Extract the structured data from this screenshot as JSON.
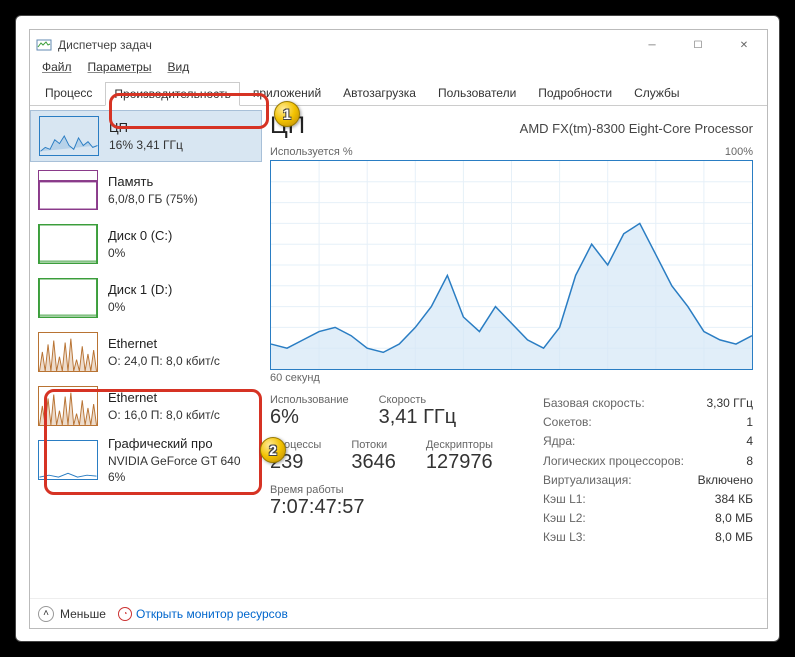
{
  "window": {
    "title": "Диспетчер задач"
  },
  "menus": {
    "file": "Файл",
    "options": "Параметры",
    "view": "Вид"
  },
  "tabs": {
    "processes": "Процесс",
    "performance": "Производительность",
    "apphistory": "приложений",
    "startup": "Автозагрузка",
    "users": "Пользователи",
    "details": "Подробности",
    "services": "Службы"
  },
  "sidebar": [
    {
      "name": "ЦП",
      "sub": "16% 3,41 ГГц",
      "color": "#2a7dc3",
      "type": "cpu"
    },
    {
      "name": "Память",
      "sub": "6,0/8,0 ГБ (75%)",
      "color": "#8a3a8a",
      "type": "mem"
    },
    {
      "name": "Диск 0 (C:)",
      "sub": "0%",
      "color": "#3b9e3b",
      "type": "disk"
    },
    {
      "name": "Диск 1 (D:)",
      "sub": "0%",
      "color": "#3b9e3b",
      "type": "disk"
    },
    {
      "name": "Ethernet",
      "sub": "О: 24,0 П: 8,0 кбит/с",
      "color": "#b87333",
      "type": "net"
    },
    {
      "name": "Ethernet",
      "sub": "О: 16,0 П: 8,0 кбит/с",
      "color": "#b87333",
      "type": "net"
    },
    {
      "name": "Графический про",
      "sub": "NVIDIA GeForce GT 640\n6%",
      "color": "#2a7dc3",
      "type": "gpu"
    }
  ],
  "main": {
    "title": "ЦП",
    "subtitle": "AMD FX(tm)-8300 Eight-Core Processor",
    "y_label": "Используется %",
    "y_max": "100%",
    "x_label": "60 секунд",
    "left_stats": {
      "usage": {
        "label": "Использование",
        "value": "6%"
      },
      "speed": {
        "label": "Скорость",
        "value": "3,41 ГГц"
      },
      "processes": {
        "label": "Процессы",
        "value": "239"
      },
      "threads": {
        "label": "Потоки",
        "value": "3646"
      },
      "handles": {
        "label": "Дескрипторы",
        "value": "127976"
      },
      "uptime_label": "Время работы",
      "uptime": "7:07:47:57"
    },
    "right_stats": [
      {
        "k": "Базовая скорость:",
        "v": "3,30 ГГц"
      },
      {
        "k": "Сокетов:",
        "v": "1"
      },
      {
        "k": "Ядра:",
        "v": "4"
      },
      {
        "k": "Логических процессоров:",
        "v": "8"
      },
      {
        "k": "Виртуализация:",
        "v": "Включено"
      },
      {
        "k": "Кэш L1:",
        "v": "384 КБ"
      },
      {
        "k": "Кэш L2:",
        "v": "8,0 МБ"
      },
      {
        "k": "Кэш L3:",
        "v": "8,0 МБ"
      }
    ]
  },
  "footer": {
    "fewer": "Меньше",
    "resmon": "Открыть монитор ресурсов"
  },
  "callouts": {
    "1": "1",
    "2": "2"
  },
  "chart_data": {
    "type": "line",
    "title": "Используется %",
    "xlabel": "60 секунд",
    "ylabel": "%",
    "ylim": [
      0,
      100
    ],
    "x": [
      0,
      2,
      4,
      6,
      8,
      10,
      12,
      14,
      16,
      18,
      20,
      22,
      24,
      26,
      28,
      30,
      32,
      34,
      36,
      38,
      40,
      42,
      44,
      46,
      48,
      50,
      52,
      54,
      56,
      58,
      60
    ],
    "values": [
      12,
      10,
      14,
      18,
      20,
      16,
      10,
      8,
      12,
      20,
      30,
      45,
      25,
      18,
      30,
      22,
      14,
      10,
      20,
      45,
      60,
      50,
      65,
      70,
      55,
      40,
      30,
      18,
      14,
      12,
      16
    ]
  }
}
